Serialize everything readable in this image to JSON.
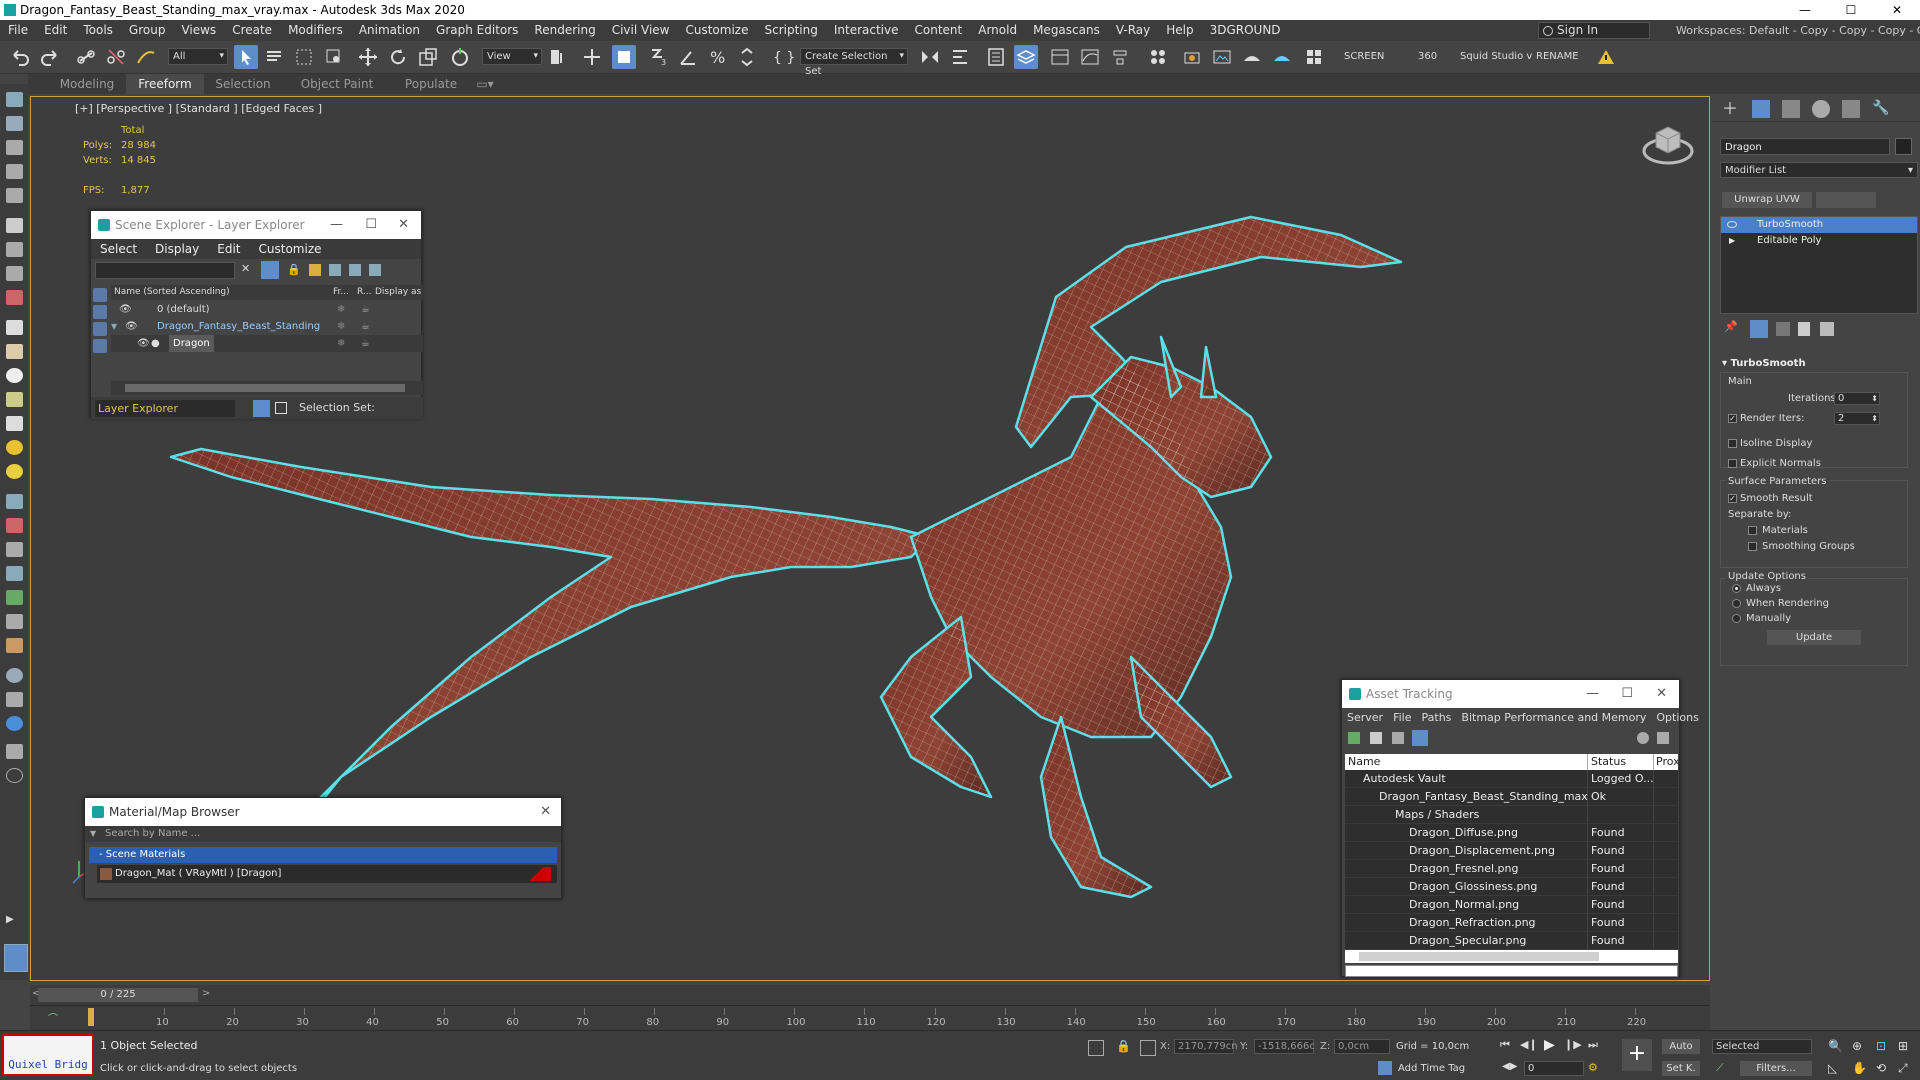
{
  "window": {
    "title": "Dragon_Fantasy_Beast_Standing_max_vray.max - Autodesk 3ds Max 2020",
    "min": "—",
    "max": "☐",
    "close": "✕"
  },
  "menu": [
    "File",
    "Edit",
    "Tools",
    "Group",
    "Views",
    "Create",
    "Modifiers",
    "Animation",
    "Graph Editors",
    "Rendering",
    "Civil View",
    "Customize",
    "Scripting",
    "Interactive",
    "Content",
    "Arnold",
    "Megascans",
    "V-Ray",
    "Help",
    "3DGROUND"
  ],
  "signin": "Sign In",
  "workspaces": "Workspaces:  Default - Copy - Copy - Copy - Copy",
  "toolbar": {
    "filter": "All",
    "refcoord": "View",
    "selset": "Create Selection Set",
    "screen": "SCREEN",
    "fps": "360",
    "squid": "Squid Studio v",
    "rename": "RENAME"
  },
  "ribbon": [
    "Modeling",
    "Freeform",
    "Selection",
    "Object Paint",
    "Populate"
  ],
  "viewport": {
    "label": "[+] [Perspective ] [Standard ] [Edged Faces ]",
    "total": "Total",
    "polys_label": "Polys:",
    "polys": "28 984",
    "verts_label": "Verts:",
    "verts": "14 845",
    "fps_label": "FPS:",
    "fps": "1,877"
  },
  "scene_explorer": {
    "title": "Scene Explorer - Layer Explorer",
    "menu": [
      "Select",
      "Display",
      "Edit",
      "Customize"
    ],
    "col_name": "Name (Sorted Ascending)",
    "col_fr": "Fr...",
    "col_r": "R...",
    "col_disp": "Display as B",
    "rows": [
      "0 (default)",
      "Dragon_Fantasy_Beast_Standing",
      "Dragon"
    ],
    "layer_explorer": "Layer Explorer",
    "selection_set": "Selection Set:"
  },
  "material_browser": {
    "title": "Material/Map Browser",
    "search": "Search by Name ...",
    "group": "- Scene Materials",
    "item": "Dragon_Mat  ( VRayMtl )  [Dragon]"
  },
  "asset_tracking": {
    "title": "Asset Tracking",
    "menu": [
      "Server",
      "File",
      "Paths",
      "Bitmap Performance and Memory",
      "Options"
    ],
    "col_name": "Name",
    "col_status": "Status",
    "col_prox": "Prox",
    "rows": [
      {
        "name": "Autodesk Vault",
        "status": "Logged O..."
      },
      {
        "name": "Dragon_Fantasy_Beast_Standing_max...",
        "status": "Ok"
      },
      {
        "name": "Maps / Shaders",
        "status": ""
      },
      {
        "name": "Dragon_Diffuse.png",
        "status": "Found"
      },
      {
        "name": "Dragon_Displacement.png",
        "status": "Found"
      },
      {
        "name": "Dragon_Fresnel.png",
        "status": "Found"
      },
      {
        "name": "Dragon_Glossiness.png",
        "status": "Found"
      },
      {
        "name": "Dragon_Normal.png",
        "status": "Found"
      },
      {
        "name": "Dragon_Refraction.png",
        "status": "Found"
      },
      {
        "name": "Dragon_Specular.png",
        "status": "Found"
      }
    ]
  },
  "command_panel": {
    "object_name": "Dragon",
    "modifier_list": "Modifier List",
    "unwrap": "Unwrap UVW",
    "stack": [
      "TurboSmooth",
      "Editable Poly"
    ],
    "turbosmooth": {
      "title": "TurboSmooth",
      "main": "Main",
      "iterations_label": "Iterations:",
      "iterations": "0",
      "render_iters_label": "Render Iters:",
      "render_iters": "2",
      "isoline": "Isoline Display",
      "explicit": "Explicit Normals",
      "surface": "Surface Parameters",
      "smooth": "Smooth Result",
      "separate": "Separate by:",
      "materials": "Materials",
      "smoothing_groups": "Smoothing Groups",
      "update_options": "Update Options",
      "always": "Always",
      "when_rendering": "When Rendering",
      "manually": "Manually",
      "update": "Update"
    }
  },
  "timeline": {
    "frame": "0 / 225",
    "ticks": [
      "10",
      "20",
      "30",
      "40",
      "50",
      "60",
      "70",
      "80",
      "90",
      "100",
      "110",
      "120",
      "130",
      "140",
      "150",
      "160",
      "170",
      "180",
      "190",
      "200",
      "210",
      "220"
    ]
  },
  "status": {
    "quixel": "Quixel Bridg",
    "selected": "1 Object Selected",
    "hint": "Click or click-and-drag to select objects",
    "x_label": "X:",
    "x": "2170,779cn",
    "y_label": "Y:",
    "y": "-1518,666c",
    "z_label": "Z:",
    "z": "0,0cm",
    "grid": "Grid = 10,0cm",
    "add_time_tag": "Add Time Tag",
    "auto": "Auto",
    "selected_drop": "Selected",
    "setk": "Set K.",
    "filters": "Filters...",
    "frame": "0"
  }
}
